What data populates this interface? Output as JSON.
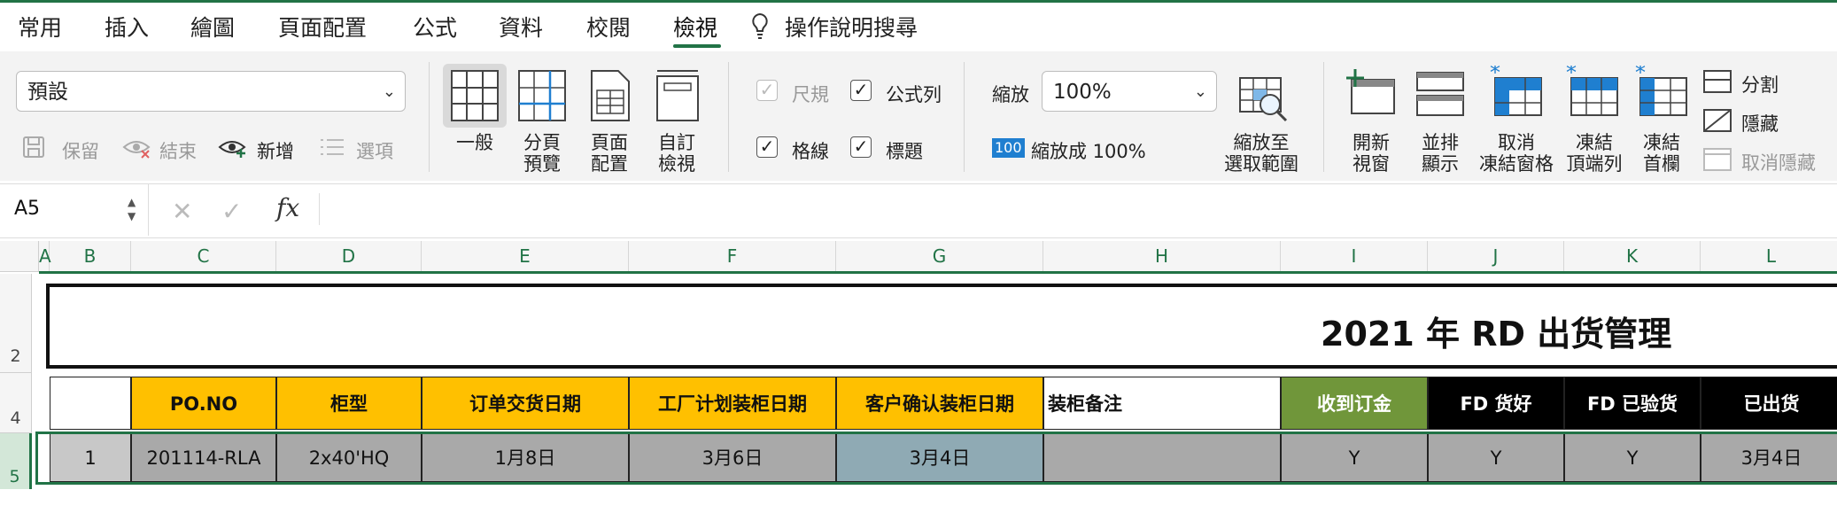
{
  "menu": {
    "tabs": [
      "常用",
      "插入",
      "繪圖",
      "頁面配置",
      "公式",
      "資料",
      "校閱",
      "檢視"
    ],
    "active_tab": "檢視",
    "help": "操作說明搜尋"
  },
  "ribbon": {
    "view_select": "預設",
    "keep": "保留",
    "exit": "結束",
    "new": "新增",
    "options": "選項",
    "views": [
      {
        "line1": "一般",
        "line2": ""
      },
      {
        "line1": "分頁",
        "line2": "預覽"
      },
      {
        "line1": "頁面",
        "line2": "配置"
      },
      {
        "line1": "自訂",
        "line2": "檢視"
      }
    ],
    "ruler": "尺規",
    "formula_bar": "公式列",
    "gridlines": "格線",
    "headings": "標題",
    "zoom_label": "縮放",
    "zoom_value": "100%",
    "zoom100_icon": "100",
    "zoom100": "縮放成 100%",
    "zoom_sel_1": "縮放至",
    "zoom_sel_2": "選取範圍",
    "new_window_1": "開新",
    "new_window_2": "視窗",
    "arrange_1": "並排",
    "arrange_2": "顯示",
    "unfreeze_1": "取消",
    "unfreeze_2": "凍結窗格",
    "freeze_top_1": "凍結",
    "freeze_top_2": "頂端列",
    "freeze_first_1": "凍結",
    "freeze_first_2": "首欄",
    "split": "分割",
    "hide": "隱藏",
    "unhide": "取消隱藏"
  },
  "formula": {
    "name_box": "A5",
    "fx": "fx"
  },
  "sheet": {
    "columns": [
      "A",
      "B",
      "C",
      "D",
      "E",
      "F",
      "G",
      "H",
      "I",
      "J",
      "K",
      "L"
    ],
    "rows": [
      "2",
      "4",
      "5"
    ],
    "title": "2021 年 RD 出货管理",
    "headers": [
      "",
      "PO.NO",
      "柜型",
      "订单交货日期",
      "工厂计划装柜日期",
      "客户确认装柜日期",
      "装柜备注",
      "收到订金",
      "FD 货好",
      "FD 已验货",
      "已出货"
    ],
    "row5": [
      "1",
      "201114-RLA",
      "2x40'HQ",
      "1月8日",
      "3月6日",
      "3月4日",
      "",
      "Y",
      "Y",
      "Y",
      "3月4日"
    ]
  },
  "colors": {
    "accent": "#217346",
    "header_orange": "#ffc000",
    "header_green": "#70963a",
    "header_black": "#000000",
    "cell_gray": "#a9a9a9",
    "cell_teal": "#8faab4",
    "icon_blue": "#1f7fd0"
  }
}
